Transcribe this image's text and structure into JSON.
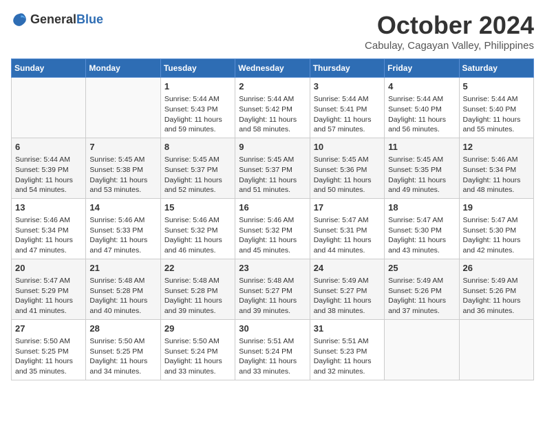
{
  "logo": {
    "text_general": "General",
    "text_blue": "Blue"
  },
  "title": "October 2024",
  "location": "Cabulay, Cagayan Valley, Philippines",
  "days_of_week": [
    "Sunday",
    "Monday",
    "Tuesday",
    "Wednesday",
    "Thursday",
    "Friday",
    "Saturday"
  ],
  "weeks": [
    [
      {
        "day": null
      },
      {
        "day": null
      },
      {
        "day": 1,
        "sunrise": "5:44 AM",
        "sunset": "5:43 PM",
        "daylight": "11 hours and 59 minutes."
      },
      {
        "day": 2,
        "sunrise": "5:44 AM",
        "sunset": "5:42 PM",
        "daylight": "11 hours and 58 minutes."
      },
      {
        "day": 3,
        "sunrise": "5:44 AM",
        "sunset": "5:41 PM",
        "daylight": "11 hours and 57 minutes."
      },
      {
        "day": 4,
        "sunrise": "5:44 AM",
        "sunset": "5:40 PM",
        "daylight": "11 hours and 56 minutes."
      },
      {
        "day": 5,
        "sunrise": "5:44 AM",
        "sunset": "5:40 PM",
        "daylight": "11 hours and 55 minutes."
      }
    ],
    [
      {
        "day": 6,
        "sunrise": "5:44 AM",
        "sunset": "5:39 PM",
        "daylight": "11 hours and 54 minutes."
      },
      {
        "day": 7,
        "sunrise": "5:45 AM",
        "sunset": "5:38 PM",
        "daylight": "11 hours and 53 minutes."
      },
      {
        "day": 8,
        "sunrise": "5:45 AM",
        "sunset": "5:37 PM",
        "daylight": "11 hours and 52 minutes."
      },
      {
        "day": 9,
        "sunrise": "5:45 AM",
        "sunset": "5:37 PM",
        "daylight": "11 hours and 51 minutes."
      },
      {
        "day": 10,
        "sunrise": "5:45 AM",
        "sunset": "5:36 PM",
        "daylight": "11 hours and 50 minutes."
      },
      {
        "day": 11,
        "sunrise": "5:45 AM",
        "sunset": "5:35 PM",
        "daylight": "11 hours and 49 minutes."
      },
      {
        "day": 12,
        "sunrise": "5:46 AM",
        "sunset": "5:34 PM",
        "daylight": "11 hours and 48 minutes."
      }
    ],
    [
      {
        "day": 13,
        "sunrise": "5:46 AM",
        "sunset": "5:34 PM",
        "daylight": "11 hours and 47 minutes."
      },
      {
        "day": 14,
        "sunrise": "5:46 AM",
        "sunset": "5:33 PM",
        "daylight": "11 hours and 47 minutes."
      },
      {
        "day": 15,
        "sunrise": "5:46 AM",
        "sunset": "5:32 PM",
        "daylight": "11 hours and 46 minutes."
      },
      {
        "day": 16,
        "sunrise": "5:46 AM",
        "sunset": "5:32 PM",
        "daylight": "11 hours and 45 minutes."
      },
      {
        "day": 17,
        "sunrise": "5:47 AM",
        "sunset": "5:31 PM",
        "daylight": "11 hours and 44 minutes."
      },
      {
        "day": 18,
        "sunrise": "5:47 AM",
        "sunset": "5:30 PM",
        "daylight": "11 hours and 43 minutes."
      },
      {
        "day": 19,
        "sunrise": "5:47 AM",
        "sunset": "5:30 PM",
        "daylight": "11 hours and 42 minutes."
      }
    ],
    [
      {
        "day": 20,
        "sunrise": "5:47 AM",
        "sunset": "5:29 PM",
        "daylight": "11 hours and 41 minutes."
      },
      {
        "day": 21,
        "sunrise": "5:48 AM",
        "sunset": "5:28 PM",
        "daylight": "11 hours and 40 minutes."
      },
      {
        "day": 22,
        "sunrise": "5:48 AM",
        "sunset": "5:28 PM",
        "daylight": "11 hours and 39 minutes."
      },
      {
        "day": 23,
        "sunrise": "5:48 AM",
        "sunset": "5:27 PM",
        "daylight": "11 hours and 39 minutes."
      },
      {
        "day": 24,
        "sunrise": "5:49 AM",
        "sunset": "5:27 PM",
        "daylight": "11 hours and 38 minutes."
      },
      {
        "day": 25,
        "sunrise": "5:49 AM",
        "sunset": "5:26 PM",
        "daylight": "11 hours and 37 minutes."
      },
      {
        "day": 26,
        "sunrise": "5:49 AM",
        "sunset": "5:26 PM",
        "daylight": "11 hours and 36 minutes."
      }
    ],
    [
      {
        "day": 27,
        "sunrise": "5:50 AM",
        "sunset": "5:25 PM",
        "daylight": "11 hours and 35 minutes."
      },
      {
        "day": 28,
        "sunrise": "5:50 AM",
        "sunset": "5:25 PM",
        "daylight": "11 hours and 34 minutes."
      },
      {
        "day": 29,
        "sunrise": "5:50 AM",
        "sunset": "5:24 PM",
        "daylight": "11 hours and 33 minutes."
      },
      {
        "day": 30,
        "sunrise": "5:51 AM",
        "sunset": "5:24 PM",
        "daylight": "11 hours and 33 minutes."
      },
      {
        "day": 31,
        "sunrise": "5:51 AM",
        "sunset": "5:23 PM",
        "daylight": "11 hours and 32 minutes."
      },
      {
        "day": null
      },
      {
        "day": null
      }
    ]
  ]
}
